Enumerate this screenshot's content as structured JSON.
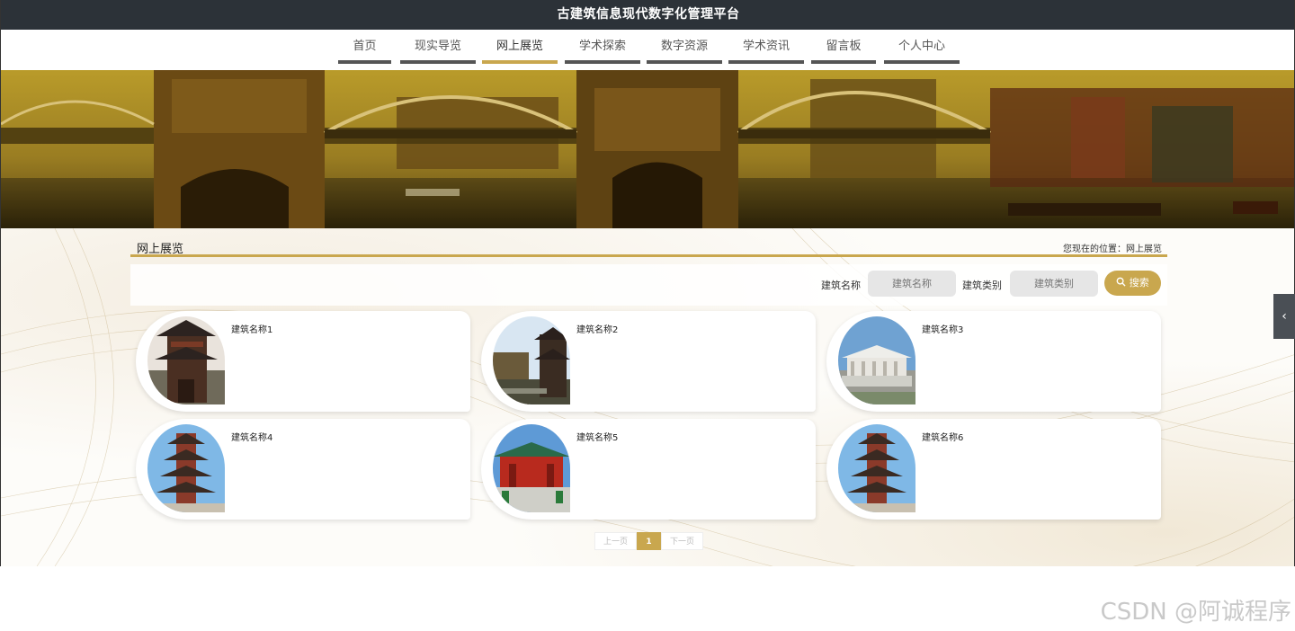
{
  "header": {
    "title": "古建筑信息现代数字化管理平台"
  },
  "nav": {
    "items": [
      {
        "label": "首页"
      },
      {
        "label": "现实导览"
      },
      {
        "label": "网上展览"
      },
      {
        "label": "学术探索"
      },
      {
        "label": "数字资源"
      },
      {
        "label": "学术资讯"
      },
      {
        "label": "留言板"
      },
      {
        "label": "个人中心"
      }
    ],
    "active": "网上展览"
  },
  "section": {
    "title": "网上展览",
    "breadcrumb": "您现在的位置：网上展览"
  },
  "search": {
    "name_label": "建筑名称",
    "name_placeholder": "建筑名称",
    "type_label": "建筑类别",
    "type_placeholder": "建筑类别",
    "button_label": "搜索"
  },
  "cards": [
    {
      "name": "建筑名称1"
    },
    {
      "name": "建筑名称2"
    },
    {
      "name": "建筑名称3"
    },
    {
      "name": "建筑名称4"
    },
    {
      "name": "建筑名称5"
    },
    {
      "name": "建筑名称6"
    }
  ],
  "pagination": {
    "prev": "上一页",
    "current": "1",
    "next": "下一页"
  },
  "watermark": "CSDN @阿诚程序",
  "colors": {
    "accent": "#c9a74e",
    "titlebar": "#2c3238",
    "nav_underline": "#555555"
  }
}
